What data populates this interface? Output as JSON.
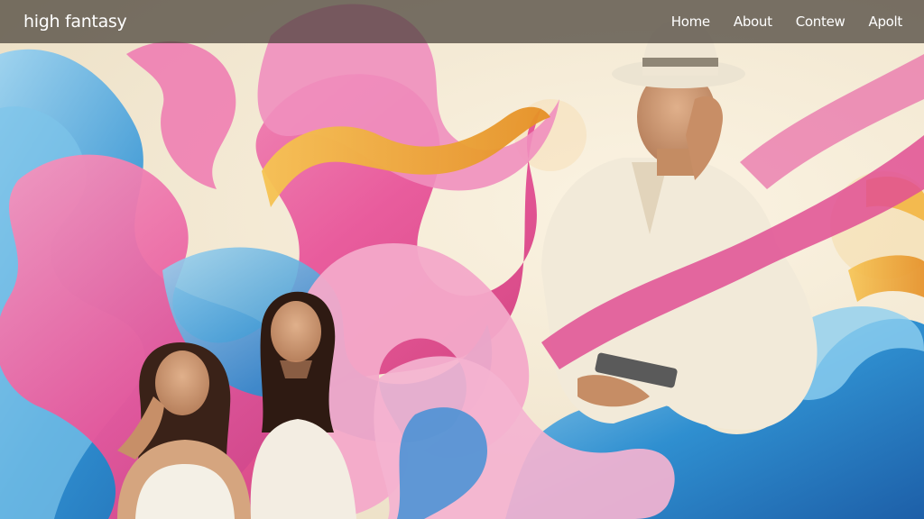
{
  "header": {
    "brand": "high fantasy",
    "nav": [
      "Home",
      "About",
      "Contew",
      "Apolt"
    ]
  },
  "hero": {
    "image_description": "Painterly illustration with swirling pink, blue and gold waves; two women on the lower left and a man in a white hat and shirt holding a tablet on the right",
    "colors": {
      "pink": "#e8559a",
      "blue": "#2f8fd0",
      "gold": "#e9a93a",
      "cream": "#f3ead8"
    }
  }
}
